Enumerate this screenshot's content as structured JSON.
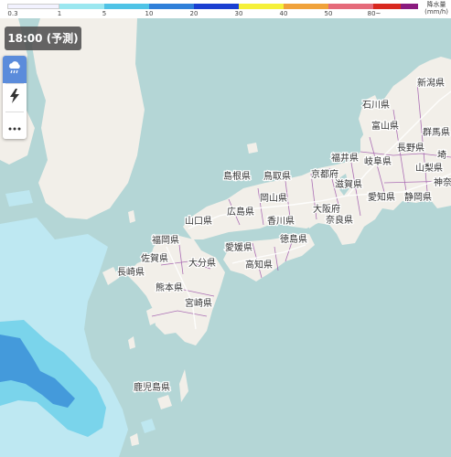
{
  "time_label": "18:00 (予測)",
  "legend": {
    "unit_title": "降水量",
    "unit": "(mm/h)",
    "ticks": [
      "0.3",
      "1",
      "5",
      "10",
      "20",
      "30",
      "40",
      "50",
      "80~"
    ],
    "colors": [
      "#f2f2ff",
      "#9be7f0",
      "#4fc3e6",
      "#2f7fd9",
      "#1a3fd1",
      "#f5f039",
      "#f0a23a",
      "#e56a7a",
      "#d8281f",
      "#8a1a7e"
    ]
  },
  "toolbar": {
    "items": [
      {
        "name": "rain-icon",
        "active": true
      },
      {
        "name": "lightning-icon",
        "active": false
      },
      {
        "name": "more-icon",
        "active": false
      }
    ]
  },
  "prefectures": [
    "新潟県",
    "石川県",
    "富山県",
    "群馬県",
    "長野県",
    "福井県",
    "岐阜県",
    "埼",
    "山梨県",
    "京都府",
    "島根県",
    "鳥取県",
    "滋賀県",
    "神奈",
    "愛知県",
    "静岡県",
    "岡山県",
    "大阪府",
    "広島県",
    "奈良県",
    "香川県",
    "山口県",
    "福岡県",
    "愛媛県",
    "徳島県",
    "佐賀県",
    "高知県",
    "大分県",
    "長崎県",
    "熊本県",
    "宮崎県",
    "鹿児島県"
  ],
  "colors": {
    "sea": "#b4d6d6",
    "land": "#f2efe9",
    "rain_light": "#bfeaf5",
    "rain_mid": "#6fd0ea",
    "rain_heavy": "#3b8fd8",
    "boundary": "#9a4fa8",
    "road": "#ffffff",
    "active_tool": "#5b8cdb"
  }
}
